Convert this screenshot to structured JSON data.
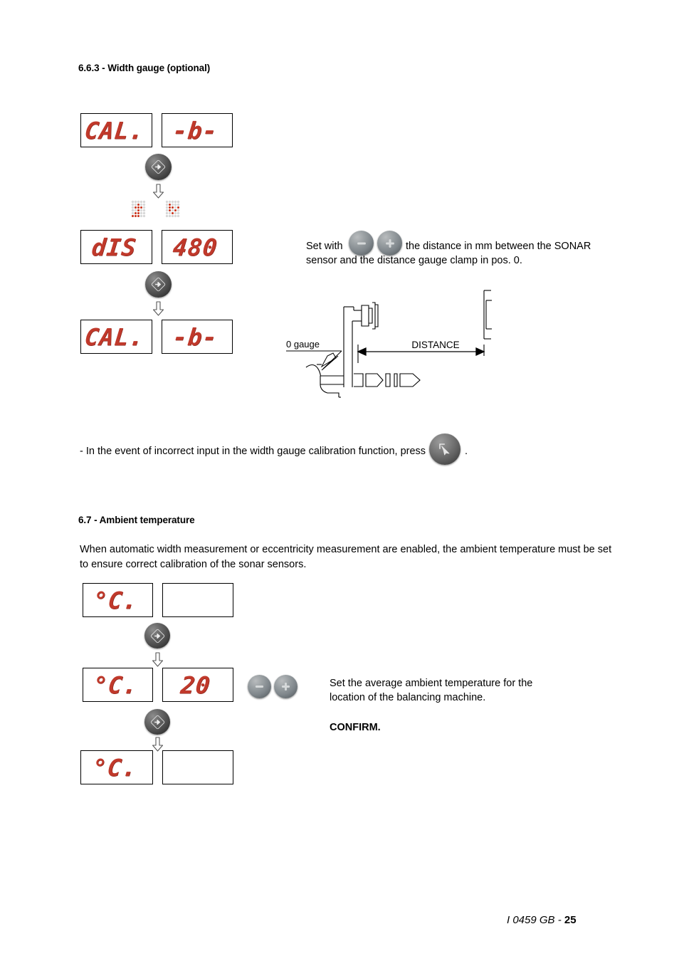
{
  "document": {
    "footer_prefix": "I 0459 GB - ",
    "page_number": "25"
  },
  "section_663": {
    "heading": "6.6.3 - Width gauge (optional)",
    "flow": {
      "step1": {
        "left_display": "CAL.",
        "right_display": "-b-"
      },
      "step2": {
        "left_display": "dIS",
        "right_display": "480"
      },
      "step3": {
        "left_display": "CAL.",
        "right_display": "-b-"
      }
    },
    "instruction": {
      "prefix": "Set with",
      "suffix_line1": "the distance in mm between the SONAR",
      "line2": "sensor and the distance gauge clamp in pos. 0."
    },
    "diagram": {
      "gauge_label": "0   gauge",
      "distance_label": "DISTANCE"
    },
    "escape_note": {
      "text": "- In the event of incorrect input in the width gauge calibration function, press",
      "trailing": "."
    }
  },
  "section_67": {
    "heading": "6.7 - Ambient temperature",
    "intro_line1": "When automatic width measurement or eccentricity measurement are enabled, the ambient temperature must be set",
    "intro_line2": "to ensure correct calibration of the sonar sensors.",
    "flow": {
      "step1": {
        "left_display": "°C.",
        "right_display": ""
      },
      "step2": {
        "left_display": "°C.",
        "right_display": "20"
      },
      "step3": {
        "left_display": "°C.",
        "right_display": ""
      }
    },
    "instruction": {
      "line1": "Set the average ambient temperature for the",
      "line2": "location of the balancing machine.",
      "confirm": "CONFIRM."
    }
  },
  "icons": {
    "enter_button": "enter-arrow-icon",
    "minus_button": "minus-icon",
    "plus_button": "plus-icon",
    "escape_button": "escape-cursor-icon",
    "down_arrow": "down-arrow-icon"
  },
  "colors": {
    "led_red": "#c0392b",
    "dot_on": "#e23b20",
    "button_dark": "#4a4a4a"
  }
}
